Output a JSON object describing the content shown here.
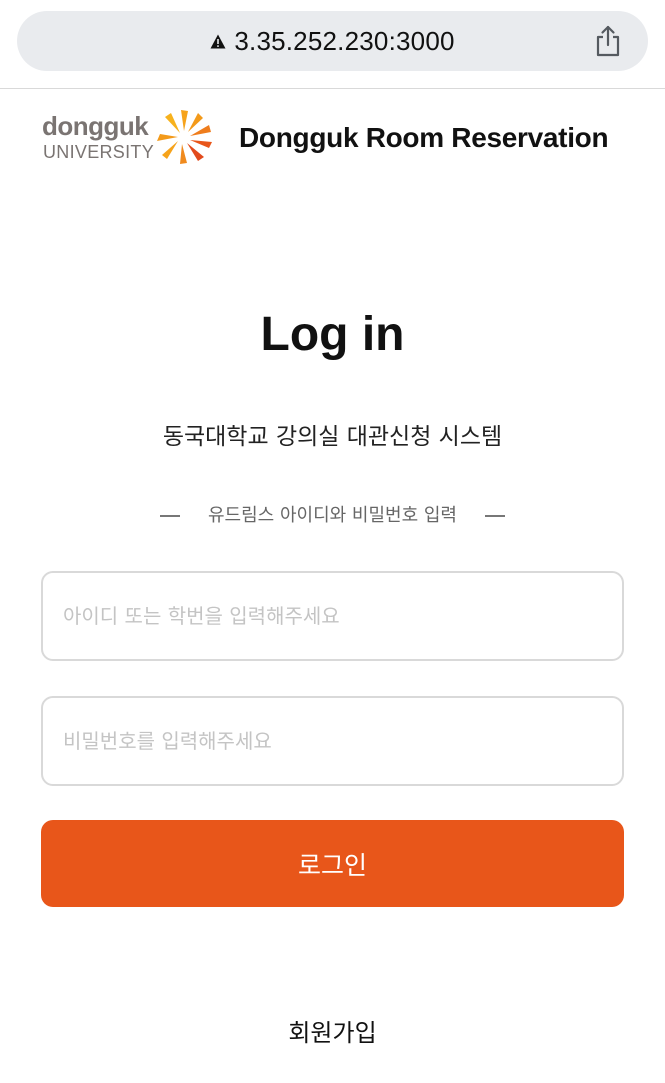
{
  "browser": {
    "url": "3.35.252.230:3000",
    "warning_icon": "warning-triangle-icon",
    "share_icon": "share-icon"
  },
  "header": {
    "logo": {
      "word": "dongguk",
      "sub": "UNIVERSITY",
      "mark_color": "#ef7d1d"
    },
    "title": "Dongguk Room Reservation"
  },
  "login": {
    "heading": "Log in",
    "subtitle": "동국대학교 강의실 대관신청 시스템",
    "divider_text": "유드림스 아이디와 비밀번호 입력",
    "id_placeholder": "아이디 또는 학번을 입력해주세요",
    "password_placeholder": "비밀번호를 입력해주세요",
    "submit_label": "로그인",
    "signup_label": "회원가입"
  },
  "colors": {
    "accent": "#e8561a",
    "input_border": "#d9d9d9",
    "placeholder": "#c4c4c4"
  }
}
